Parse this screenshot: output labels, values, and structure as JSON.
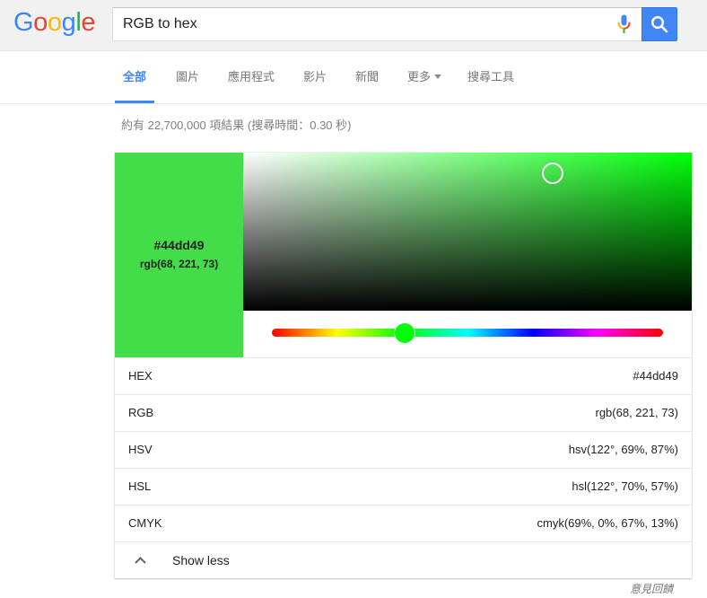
{
  "logo": {
    "letters": [
      "G",
      "o",
      "o",
      "g",
      "l",
      "e"
    ],
    "colors": [
      "#4285f4",
      "#ea4335",
      "#fbbc05",
      "#4285f4",
      "#34a853",
      "#ea4335"
    ]
  },
  "search": {
    "query": "RGB to hex",
    "mic_icon": "microphone-icon",
    "search_icon": "magnifier-icon"
  },
  "tabs": [
    {
      "label": "全部",
      "active": true
    },
    {
      "label": "圖片"
    },
    {
      "label": "應用程式"
    },
    {
      "label": "影片"
    },
    {
      "label": "新聞"
    },
    {
      "label": "更多",
      "icon": "caret-down-icon"
    },
    {
      "label": "搜尋工具"
    }
  ],
  "result_stats": "約有 22,700,000 項結果 (搜尋時間：0.30 秒)",
  "color_picker": {
    "swatch_color": "#44dd49",
    "swatch": {
      "hex": "#44dd49",
      "rgb": "rgb(68, 221, 73)"
    },
    "hue_degrees": 122,
    "saturation": 0.69,
    "value": 0.87,
    "pure_hue_color": "#00ff09",
    "rows": [
      {
        "label": "HEX",
        "value": "#44dd49"
      },
      {
        "label": "RGB",
        "value": "rgb(68, 221, 73)"
      },
      {
        "label": "HSV",
        "value": "hsv(122°, 69%, 87%)"
      },
      {
        "label": "HSL",
        "value": "hsl(122°, 70%, 57%)"
      },
      {
        "label": "CMYK",
        "value": "cmyk(69%, 0%, 67%, 13%)"
      }
    ],
    "toggle": {
      "label": "Show less",
      "icon": "chevron-up-icon"
    }
  },
  "feedback": "意見回饋",
  "colors": {
    "accent": "#4285f4",
    "header_bg": "#f1f1f1"
  }
}
